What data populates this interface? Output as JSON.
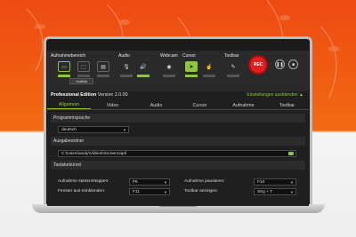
{
  "toolbar": {
    "groups": {
      "aufnahmebereich": "Aufnahmebereich",
      "audio": "Audio",
      "webcam": "Webcam",
      "cursor": "Cursor",
      "toolbar": "Toolbar"
    },
    "vollbild_label": "Vollbild",
    "rec_label": "REC",
    "icons": {
      "fullscreen": "monitor-icon",
      "region": "region-select-icon",
      "window": "window-icon",
      "microphone": "microphone-icon",
      "speaker": "speaker-icon",
      "webcam": "webcam-icon",
      "cursor": "cursor-arrow-icon",
      "click": "click-icon",
      "tools": "wrench-icon",
      "pause": "pause-icon",
      "stop": "stop-icon"
    },
    "accent_color": "#8dc63f",
    "rec_color": "#e02020"
  },
  "header": {
    "edition": "Professional Edition",
    "version": "Version 2.0.00",
    "hide_settings": "Einstellungen ausblenden ▲"
  },
  "tabs": [
    {
      "label": "Allgemein",
      "active": true
    },
    {
      "label": "Video",
      "active": false
    },
    {
      "label": "Audio",
      "active": false
    },
    {
      "label": "Cursor",
      "active": false
    },
    {
      "label": "Aufnahme",
      "active": false
    },
    {
      "label": "Toolbar",
      "active": false
    }
  ],
  "settings": {
    "language_section": "Programmsprache",
    "language_value": "deutsch",
    "output_section": "Ausgabeordner",
    "output_path": "C:\\Users\\andy\\Videos\\Screencapt\\",
    "hotkeys_section": "Tastaturkürzel",
    "hotkeys": [
      {
        "label": "Aufnahme starten/stoppen:",
        "value": "F9"
      },
      {
        "label": "Aufnahme pausieren:",
        "value": "F10"
      },
      {
        "label": "Fenster aus-/einblenden:",
        "value": "F11"
      },
      {
        "label": "Toolbar anzeigen:",
        "value": "Strg + T"
      }
    ]
  }
}
